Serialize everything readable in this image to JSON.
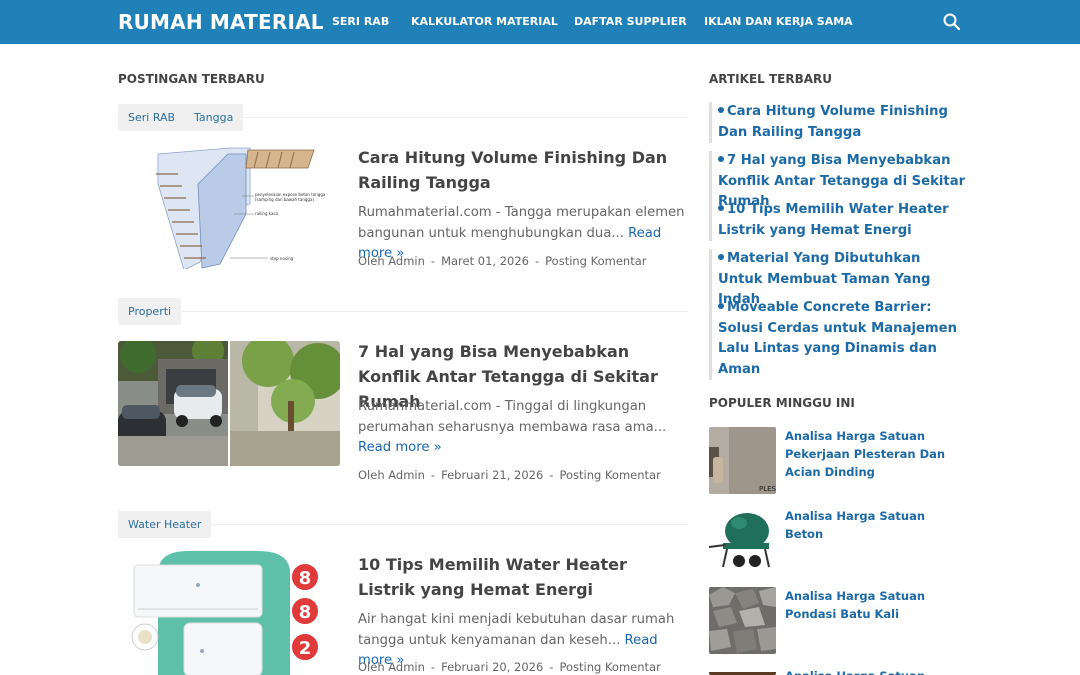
{
  "brand": "RUMAH MATERIAL",
  "nav": [
    "SERI RAB",
    "KALKULATOR MATERIAL",
    "DAFTAR SUPPLIER",
    "IKLAN DAN KERJA SAMA"
  ],
  "search_icon": "search-icon",
  "posts_title": "POSTINGAN TERBARU",
  "posts": [
    {
      "tags": [
        "Seri RAB",
        "Tangga"
      ],
      "title": "Cara Hitung Volume Finishing Dan Railing Tangga",
      "excerpt": "Rumahmaterial.com - Tangga merupakan elemen bangunan untuk menghubungkan dua...",
      "read_more": "Read more »",
      "author": "Oleh Admin",
      "date": "Maret 01, 2026",
      "comment": "Posting Komentar",
      "image_labels": [
        "penyelesaian expose beton tangga",
        "(samping dan bawah tangga)",
        "railing kaca",
        "step nosing"
      ]
    },
    {
      "tags": [
        "Properti"
      ],
      "title": "7 Hal yang Bisa Menyebabkan Konflik Antar Tetangga di Sekitar Rumah",
      "excerpt": "Rumahmaterial.com - Tinggal di lingkungan perumahan seharusnya membawa rasa ama...",
      "read_more": "Read more »",
      "author": "Oleh Admin",
      "date": "Februari 21, 2026",
      "comment": "Posting Komentar"
    },
    {
      "tags": [
        "Water Heater"
      ],
      "title": "10 Tips Memilih Water Heater Listrik yang Hemat Energi",
      "excerpt": "Air hangat kini menjadi kebutuhan dasar rumah tangga untuk kenyamanan dan keseh...",
      "read_more": "Read more »",
      "author": "Oleh Admin",
      "date": "Februari 20, 2026",
      "comment": "Posting Komentar",
      "image_badges": [
        "8",
        "8",
        "2"
      ]
    }
  ],
  "latest_title": "ARTIKEL TERBARU",
  "latest": [
    "Cara Hitung Volume Finishing Dan Railing Tangga",
    "7 Hal yang Bisa Menyebabkan Konflik Antar Tetangga di Sekitar Rumah",
    "10 Tips Memilih Water Heater Listrik yang Hemat Energi",
    "Material Yang Dibutuhkan Untuk Membuat Taman Yang Indah",
    "Moveable Concrete Barrier: Solusi Cerdas untuk Manajemen Lalu Lintas yang Dinamis dan Aman"
  ],
  "popular_title": "POPULER MINGGU INI",
  "popular": [
    {
      "title": "Analisa Harga Satuan Pekerjaan Plesteran Dan Acian Dinding",
      "thumb_text": "PLES"
    },
    {
      "title": "Analisa Harga Satuan Beton"
    },
    {
      "title": "Analisa Harga Satuan Pondasi Batu Kali"
    },
    {
      "title": "Analisa Harga Satuan Pekerjaan"
    }
  ],
  "colors": {
    "header": "#2080b8",
    "link": "#1e6aa6",
    "text": "#555555"
  }
}
